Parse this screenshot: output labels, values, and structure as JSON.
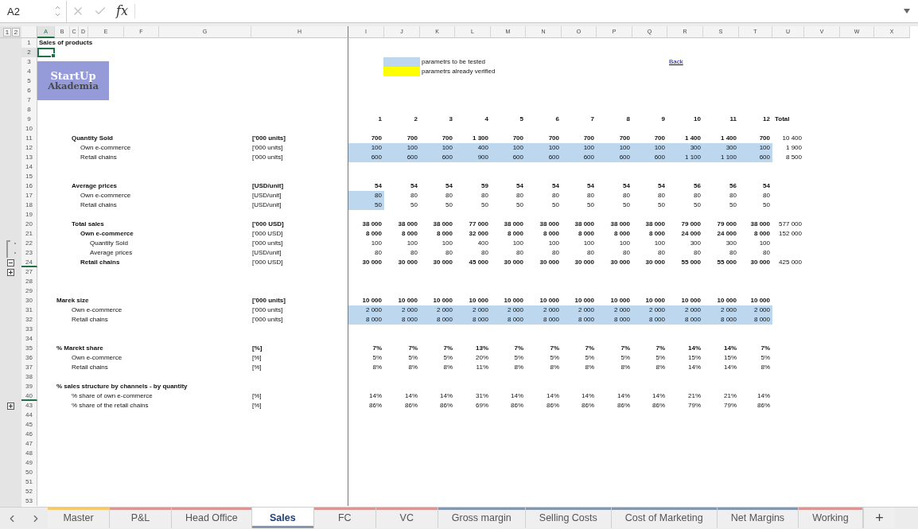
{
  "name_box": "A2",
  "formula_label": "fx",
  "outline_levels": [
    "1",
    "2"
  ],
  "columns": [
    {
      "letter": "A",
      "selected": true
    },
    {
      "letter": "B",
      "selected": false
    },
    {
      "letter": "C",
      "selected": false
    },
    {
      "letter": "D",
      "selected": false
    },
    {
      "letter": "E",
      "selected": false
    },
    {
      "letter": "F",
      "selected": false
    },
    {
      "letter": "G",
      "selected": false
    },
    {
      "letter": "H",
      "selected": false
    },
    {
      "letter": "I",
      "selected": false
    },
    {
      "letter": "J",
      "selected": false
    },
    {
      "letter": "K",
      "selected": false
    },
    {
      "letter": "L",
      "selected": false
    },
    {
      "letter": "M",
      "selected": false
    },
    {
      "letter": "N",
      "selected": false
    },
    {
      "letter": "O",
      "selected": false
    },
    {
      "letter": "P",
      "selected": false
    },
    {
      "letter": "Q",
      "selected": false
    },
    {
      "letter": "R",
      "selected": false
    },
    {
      "letter": "S",
      "selected": false
    },
    {
      "letter": "T",
      "selected": false
    },
    {
      "letter": "U",
      "selected": false
    },
    {
      "letter": "V",
      "selected": false
    },
    {
      "letter": "W",
      "selected": false
    },
    {
      "letter": "X",
      "selected": false
    }
  ],
  "rows": [
    {
      "number": "1",
      "selected": false,
      "kind": "title",
      "label": "Sales of products",
      "bold": true
    },
    {
      "number": "2",
      "selected": true
    },
    {
      "number": "3",
      "selected": false,
      "logo": {
        "title": "StartUp",
        "subtitle": "Akademia"
      },
      "legend": {
        "color": "#bdd7ee",
        "text": "parametrs to be tested"
      },
      "link": "Back"
    },
    {
      "number": "4",
      "selected": false,
      "legend": {
        "color": "#ffff00",
        "text": "parametrs already verified"
      }
    },
    {
      "number": "5",
      "selected": false
    },
    {
      "number": "6",
      "selected": false
    },
    {
      "number": "7",
      "selected": false
    },
    {
      "number": "8",
      "selected": false
    },
    {
      "number": "9",
      "selected": false,
      "kind": "header",
      "bold": true,
      "values": [
        "1",
        "2",
        "3",
        "4",
        "5",
        "6",
        "7",
        "8",
        "9",
        "10",
        "11",
        "12"
      ],
      "total": "Total"
    },
    {
      "number": "10",
      "selected": false
    },
    {
      "number": "11",
      "selected": false,
      "kind": "group",
      "label": "Quantity Sold",
      "unit": "['000 units]",
      "bold": true,
      "values": [
        "700",
        "700",
        "700",
        "1 300",
        "700",
        "700",
        "700",
        "700",
        "700",
        "1 400",
        "1 400",
        "700"
      ],
      "total": "10 400"
    },
    {
      "number": "12",
      "selected": false,
      "kind": "item",
      "label": "Own e-commerce",
      "unit": "['000 units]",
      "bold": false,
      "values": [
        {
          "text": "100",
          "highlighted": true
        },
        {
          "text": "100",
          "highlighted": true
        },
        {
          "text": "100",
          "highlighted": true
        },
        {
          "text": "400",
          "highlighted": true
        },
        {
          "text": "100",
          "highlighted": true
        },
        {
          "text": "100",
          "highlighted": true
        },
        {
          "text": "100",
          "highlighted": true
        },
        {
          "text": "100",
          "highlighted": true
        },
        {
          "text": "100",
          "highlighted": true
        },
        {
          "text": "300",
          "highlighted": true
        },
        {
          "text": "300",
          "highlighted": true
        },
        {
          "text": "100",
          "highlighted": true
        }
      ],
      "total": "1 900"
    },
    {
      "number": "13",
      "selected": false,
      "kind": "item",
      "label": "Retail chains",
      "unit": "['000 units]",
      "bold": false,
      "values": [
        {
          "text": "600",
          "highlighted": true
        },
        {
          "text": "600",
          "highlighted": true
        },
        {
          "text": "600",
          "highlighted": true
        },
        {
          "text": "900",
          "highlighted": true
        },
        {
          "text": "600",
          "highlighted": true
        },
        {
          "text": "600",
          "highlighted": true
        },
        {
          "text": "600",
          "highlighted": true
        },
        {
          "text": "600",
          "highlighted": true
        },
        {
          "text": "600",
          "highlighted": true
        },
        {
          "text": "1 100",
          "highlighted": true
        },
        {
          "text": "1 100",
          "highlighted": true
        },
        {
          "text": "600",
          "highlighted": true
        }
      ],
      "total": "8 500"
    },
    {
      "number": "14",
      "selected": false
    },
    {
      "number": "15",
      "selected": false
    },
    {
      "number": "16",
      "selected": false,
      "kind": "group",
      "label": "Average prices",
      "unit": "[USD/unit]",
      "bold": true,
      "values": [
        "54",
        "54",
        "54",
        "59",
        "54",
        "54",
        "54",
        "54",
        "54",
        "56",
        "56",
        "54"
      ]
    },
    {
      "number": "17",
      "selected": false,
      "kind": "item",
      "label": "Own e-commerce",
      "unit": "[USD/unit]",
      "bold": false,
      "values": [
        {
          "text": "80",
          "highlighted": true
        },
        {
          "text": "80",
          "highlighted": false
        },
        {
          "text": "80",
          "highlighted": false
        },
        {
          "text": "80",
          "highlighted": false
        },
        {
          "text": "80",
          "highlighted": false
        },
        {
          "text": "80",
          "highlighted": false
        },
        {
          "text": "80",
          "highlighted": false
        },
        {
          "text": "80",
          "highlighted": false
        },
        {
          "text": "80",
          "highlighted": false
        },
        {
          "text": "80",
          "highlighted": false
        },
        {
          "text": "80",
          "highlighted": false
        },
        {
          "text": "80",
          "highlighted": false
        }
      ]
    },
    {
      "number": "18",
      "selected": false,
      "kind": "item",
      "label": "Retail chains",
      "unit": "[USD/unit]",
      "bold": false,
      "values": [
        {
          "text": "50",
          "highlighted": true
        },
        {
          "text": "50",
          "highlighted": false
        },
        {
          "text": "50",
          "highlighted": false
        },
        {
          "text": "50",
          "highlighted": false
        },
        {
          "text": "50",
          "highlighted": false
        },
        {
          "text": "50",
          "highlighted": false
        },
        {
          "text": "50",
          "highlighted": false
        },
        {
          "text": "50",
          "highlighted": false
        },
        {
          "text": "50",
          "highlighted": false
        },
        {
          "text": "50",
          "highlighted": false
        },
        {
          "text": "50",
          "highlighted": false
        },
        {
          "text": "50",
          "highlighted": false
        }
      ]
    },
    {
      "number": "19",
      "selected": false
    },
    {
      "number": "20",
      "selected": false,
      "kind": "group",
      "label": "Total sales",
      "unit": "['000 USD]",
      "bold": true,
      "values": [
        "38 000",
        "38 000",
        "38 000",
        "77 000",
        "38 000",
        "38 000",
        "38 000",
        "38 000",
        "38 000",
        "79 000",
        "79 000",
        "38 000"
      ],
      "total": "577 000"
    },
    {
      "number": "21",
      "selected": false,
      "kind": "item",
      "label": "Own e-commerce",
      "unit": "['000 USD]",
      "bold": true,
      "values": [
        "8 000",
        "8 000",
        "8 000",
        "32 000",
        "8 000",
        "8 000",
        "8 000",
        "8 000",
        "8 000",
        "24 000",
        "24 000",
        "8 000"
      ],
      "total": "152 000"
    },
    {
      "number": "22",
      "selected": false,
      "kind": "detail",
      "label": "Quantity Sold",
      "unit": "['000 units]",
      "bold": false,
      "outline": {
        "kind": "bracket"
      },
      "values": [
        "100",
        "100",
        "100",
        "400",
        "100",
        "100",
        "100",
        "100",
        "100",
        "300",
        "300",
        "100"
      ]
    },
    {
      "number": "23",
      "selected": false,
      "kind": "detail",
      "label": "Average prices",
      "unit": "[USD/unit]",
      "bold": false,
      "outline": {
        "kind": "bracket_end"
      },
      "values": [
        "80",
        "80",
        "80",
        "80",
        "80",
        "80",
        "80",
        "80",
        "80",
        "80",
        "80",
        "80"
      ]
    },
    {
      "number": "24",
      "selected": false,
      "kind": "item",
      "label": "Retail chains",
      "unit": "['000 USD]",
      "bold": true,
      "outline": {
        "kind": "collapse"
      },
      "hidden_below": true,
      "values": [
        "30 000",
        "30 000",
        "30 000",
        "45 000",
        "30 000",
        "30 000",
        "30 000",
        "30 000",
        "30 000",
        "55 000",
        "55 000",
        "30 000"
      ],
      "total": "425 000"
    },
    {
      "number": "27",
      "selected": false,
      "outline": {
        "kind": "expand"
      }
    },
    {
      "number": "28",
      "selected": false
    },
    {
      "number": "29",
      "selected": false
    },
    {
      "number": "30",
      "selected": false,
      "kind": "section",
      "label": "Marek size",
      "unit": "['000 units]",
      "bold": true,
      "values": [
        "10 000",
        "10 000",
        "10 000",
        "10 000",
        "10 000",
        "10 000",
        "10 000",
        "10 000",
        "10 000",
        "10 000",
        "10 000",
        "10 000"
      ]
    },
    {
      "number": "31",
      "selected": false,
      "kind": "group",
      "label": "Own e-commerce",
      "unit": "['000 units]",
      "bold": false,
      "values": [
        {
          "text": "2 000",
          "highlighted": true
        },
        {
          "text": "2 000",
          "highlighted": true
        },
        {
          "text": "2 000",
          "highlighted": true
        },
        {
          "text": "2 000",
          "highlighted": true
        },
        {
          "text": "2 000",
          "highlighted": true
        },
        {
          "text": "2 000",
          "highlighted": true
        },
        {
          "text": "2 000",
          "highlighted": true
        },
        {
          "text": "2 000",
          "highlighted": true
        },
        {
          "text": "2 000",
          "highlighted": true
        },
        {
          "text": "2 000",
          "highlighted": true
        },
        {
          "text": "2 000",
          "highlighted": true
        },
        {
          "text": "2 000",
          "highlighted": true
        }
      ]
    },
    {
      "number": "32",
      "selected": false,
      "kind": "group",
      "label": "Retail chains",
      "unit": "['000 units]",
      "bold": false,
      "values": [
        {
          "text": "8 000",
          "highlighted": true
        },
        {
          "text": "8 000",
          "highlighted": true
        },
        {
          "text": "8 000",
          "highlighted": true
        },
        {
          "text": "8 000",
          "highlighted": true
        },
        {
          "text": "8 000",
          "highlighted": true
        },
        {
          "text": "8 000",
          "highlighted": true
        },
        {
          "text": "8 000",
          "highlighted": true
        },
        {
          "text": "8 000",
          "highlighted": true
        },
        {
          "text": "8 000",
          "highlighted": true
        },
        {
          "text": "8 000",
          "highlighted": true
        },
        {
          "text": "8 000",
          "highlighted": true
        },
        {
          "text": "8 000",
          "highlighted": true
        }
      ]
    },
    {
      "number": "33",
      "selected": false
    },
    {
      "number": "34",
      "selected": false
    },
    {
      "number": "35",
      "selected": false,
      "kind": "section",
      "label": "% Marekt share",
      "unit": "[%]",
      "bold": true,
      "values": [
        "7%",
        "7%",
        "7%",
        "13%",
        "7%",
        "7%",
        "7%",
        "7%",
        "7%",
        "14%",
        "14%",
        "7%"
      ]
    },
    {
      "number": "36",
      "selected": false,
      "kind": "group",
      "label": "Own e-commerce",
      "unit": "[%]",
      "bold": false,
      "values": [
        "5%",
        "5%",
        "5%",
        "20%",
        "5%",
        "5%",
        "5%",
        "5%",
        "5%",
        "15%",
        "15%",
        "5%"
      ]
    },
    {
      "number": "37",
      "selected": false,
      "kind": "group",
      "label": "Retail chains",
      "unit": "[%]",
      "bold": false,
      "values": [
        "8%",
        "8%",
        "8%",
        "11%",
        "8%",
        "8%",
        "8%",
        "8%",
        "8%",
        "14%",
        "14%",
        "8%"
      ]
    },
    {
      "number": "38",
      "selected": false
    },
    {
      "number": "39",
      "selected": false,
      "kind": "section",
      "label": "% sales structure by channels - by quantity",
      "bold": true
    },
    {
      "number": "40",
      "selected": false,
      "kind": "group",
      "label": "% share of own e-commerce",
      "unit": "[%]",
      "bold": false,
      "hidden_below": true,
      "values": [
        "14%",
        "14%",
        "14%",
        "31%",
        "14%",
        "14%",
        "14%",
        "14%",
        "14%",
        "21%",
        "21%",
        "14%"
      ]
    },
    {
      "number": "43",
      "selected": false,
      "kind": "group",
      "label": "% share of the retail chains",
      "unit": "[%]",
      "bold": false,
      "outline": {
        "kind": "expand"
      },
      "values": [
        "86%",
        "86%",
        "86%",
        "69%",
        "86%",
        "86%",
        "86%",
        "86%",
        "86%",
        "79%",
        "79%",
        "86%"
      ]
    },
    {
      "number": "44",
      "selected": false
    },
    {
      "number": "45",
      "selected": false
    },
    {
      "number": "46",
      "selected": false
    },
    {
      "number": "47",
      "selected": false
    },
    {
      "number": "48",
      "selected": false
    },
    {
      "number": "49",
      "selected": false
    },
    {
      "number": "50",
      "selected": false
    },
    {
      "number": "51",
      "selected": false
    },
    {
      "number": "52",
      "selected": false
    },
    {
      "number": "53",
      "selected": false
    }
  ],
  "tabs": [
    {
      "label": "Master",
      "color": "#f3c96b",
      "selected": false
    },
    {
      "label": "P&L",
      "color": "#d99694",
      "selected": false
    },
    {
      "label": "Head Office",
      "color": "#d99694",
      "selected": false
    },
    {
      "label": "Sales",
      "color": "#8496b0",
      "selected": true
    },
    {
      "label": "FC",
      "color": "#d99694",
      "selected": false
    },
    {
      "label": "VC",
      "color": "#d99694",
      "selected": false
    },
    {
      "label": "Gross margin",
      "color": "#8496b0",
      "selected": false
    },
    {
      "label": "Selling Costs",
      "color": "#8496b0",
      "selected": false
    },
    {
      "label": "Cost of Marketing",
      "color": "#8496b0",
      "selected": false
    },
    {
      "label": "Net Margins",
      "color": "#8496b0",
      "selected": false
    },
    {
      "label": "Working",
      "color": "#d99694",
      "selected": false
    }
  ],
  "add_tab": "+"
}
